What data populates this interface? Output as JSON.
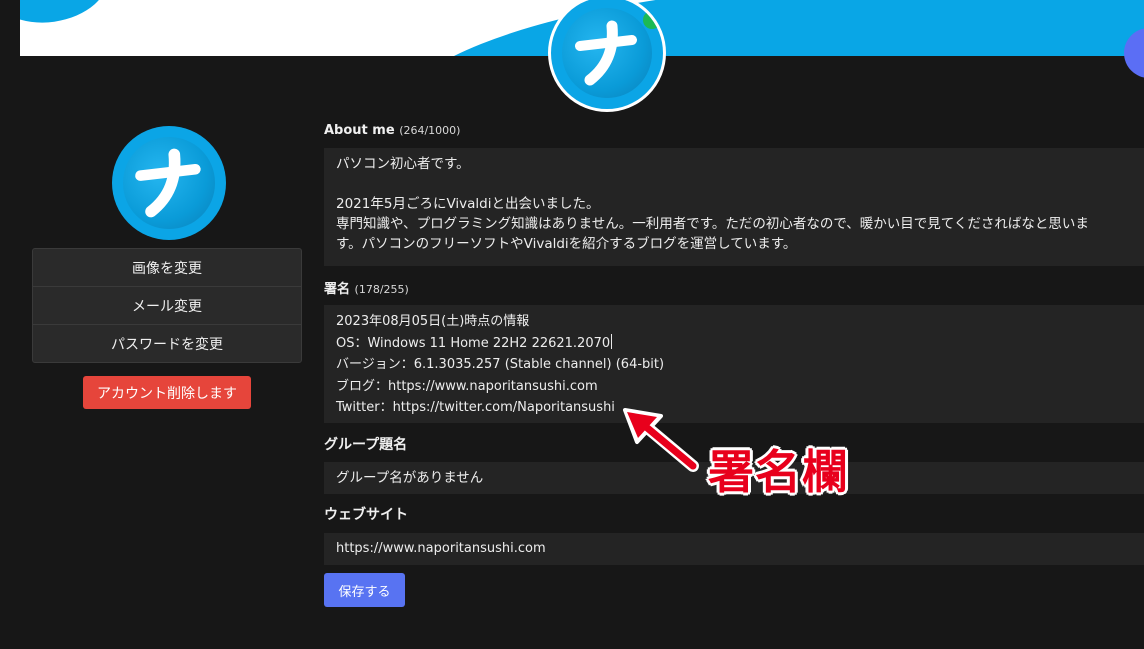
{
  "about": {
    "label": "About me",
    "count": "(264/1000)",
    "lines": [
      "パソコン初心者です。",
      "",
      "2021年5月ごろにVivaldiと出会いました。",
      "専門知識や、プログラミング知識はありません。一利用者です。ただの初心者なので、暖かい目で見てくださればなと思いま",
      "す。パソコンのフリーソフトやVivaldiを紹介するブログを運営しています。"
    ]
  },
  "signature": {
    "label": "署名",
    "count": "(178/255)",
    "lines": [
      "2023年08月05日(土)時点の情報",
      "OS：Windows 11 Home 22H2 22621.2070",
      "バージョン：6.1.3035.257 (Stable channel) (64-bit)",
      "ブログ：https://www.naporitansushi.com",
      "Twitter：https://twitter.com/Naporitansushi"
    ]
  },
  "group": {
    "label": "グループ題名",
    "value": "グループ名がありません"
  },
  "website": {
    "label": "ウェブサイト",
    "value": "https://www.naporitansushi.com"
  },
  "menu": {
    "change_image": "画像を変更",
    "change_email": "メール変更",
    "change_password": "パスワードを変更",
    "delete_account": "アカウント削除します"
  },
  "save_label": "保存する",
  "annotation": "署名欄",
  "colors": {
    "background": "#171717",
    "field": "#242424",
    "accent_blue": "#5873f2",
    "danger": "#e6453b",
    "banner_blue": "#09a6e6",
    "annotation_red": "#e8001c"
  }
}
